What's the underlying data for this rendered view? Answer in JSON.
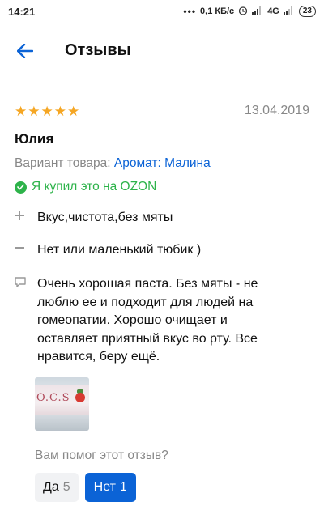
{
  "status_bar": {
    "time": "14:21",
    "dots": "•••",
    "speed": "0,1 КБ/с",
    "network": "4G",
    "battery": "23"
  },
  "header": {
    "title": "Отзывы"
  },
  "review": {
    "rating": 5,
    "date": "13.04.2019",
    "author": "Юлия",
    "variant_label": "Вариант товара:",
    "variant_value": "Аромат: Малина",
    "verified_text": "Я купил это на OZON",
    "pros": "Вкус,чистота,без мяты",
    "cons": "Нет или маленький тюбик )",
    "comment": "Очень хорошая паста. Без мяты - не люблю ее и подходит для людей на гомеопатии. Хорошо очищает и оставляет приятный вкус во рту. Все нравится, беру ещё.",
    "photo_text": "O.C.S"
  },
  "helpful": {
    "question": "Вам помог этот отзыв?",
    "yes_label": "Да",
    "yes_count": "5",
    "no_label": "Нет",
    "no_count": "1"
  },
  "colors": {
    "accent": "#0b63d6",
    "star": "#f5a623",
    "verified": "#2db34a"
  }
}
